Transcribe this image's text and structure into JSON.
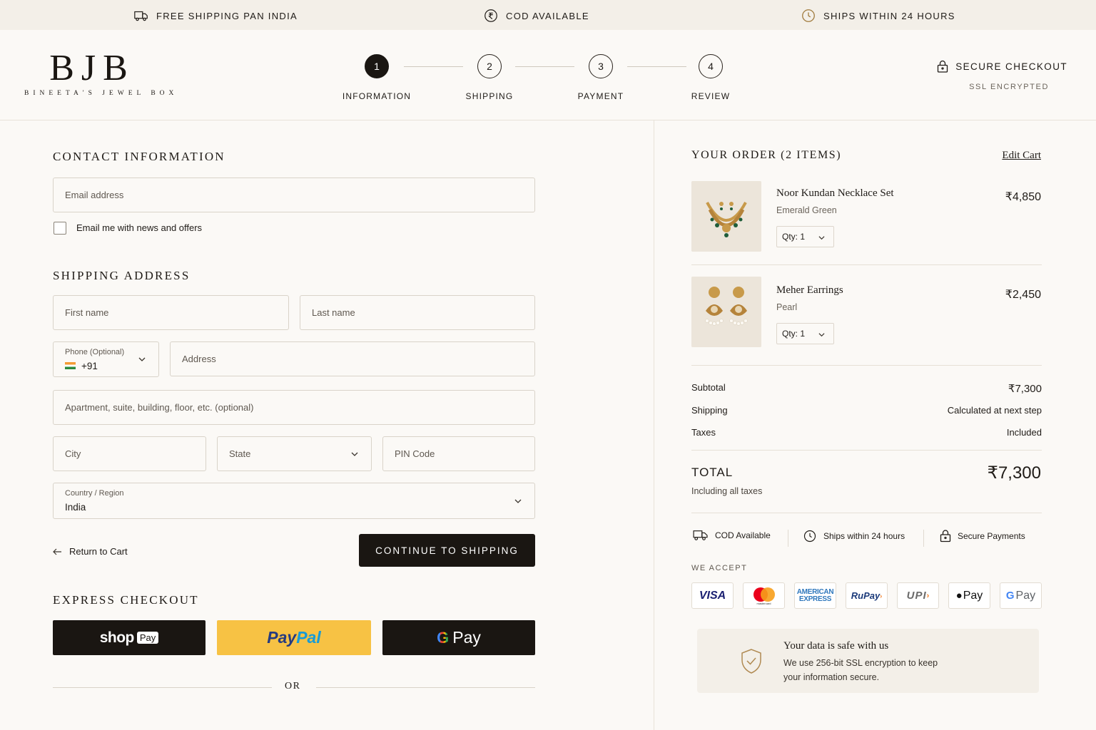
{
  "topbar": {
    "items": [
      {
        "label": "FREE SHIPPING PAN INDIA",
        "icon": "truck-icon"
      },
      {
        "label": "COD AVAILABLE",
        "icon": "rupee-coin-icon"
      },
      {
        "label": "SHIPS WITHIN 24 HOURS",
        "icon": "clock-icon"
      }
    ]
  },
  "brand": {
    "mark": "BJB",
    "name": "BINEETA'S JEWEL BOX"
  },
  "steps": [
    {
      "num": "1",
      "label": "INFORMATION",
      "active": true
    },
    {
      "num": "2",
      "label": "SHIPPING",
      "active": false
    },
    {
      "num": "3",
      "label": "PAYMENT",
      "active": false
    },
    {
      "num": "4",
      "label": "REVIEW",
      "active": false
    }
  ],
  "secure": {
    "title": "SECURE CHECKOUT",
    "sub": "SSL ENCRYPTED"
  },
  "contact": {
    "title": "CONTACT INFORMATION",
    "email_placeholder": "Email address",
    "newsletter_label": "Email me with news and offers"
  },
  "shipping": {
    "title": "SHIPPING ADDRESS",
    "first_name": "First name",
    "last_name": "Last name",
    "phone_label": "Phone (Optional)",
    "phone_code": "+91",
    "address": "Address",
    "apartment": "Apartment, suite, building, floor, etc. (optional)",
    "city": "City",
    "state": "State",
    "pin": "PIN Code",
    "country_label": "Country / Region",
    "country_value": "India"
  },
  "actions": {
    "return": "Return to Cart",
    "continue": "CONTINUE TO SHIPPING"
  },
  "express": {
    "title": "EXPRESS CHECKOUT",
    "shop_pay": "shop",
    "shop_pay_badge": "Pay",
    "paypal_a": "Pay",
    "paypal_b": "Pal",
    "gpay_g": "G",
    "gpay": "Pay",
    "or": "OR"
  },
  "order": {
    "title": "YOUR ORDER (2 ITEMS)",
    "edit": "Edit Cart",
    "items": [
      {
        "name": "Noor Kundan Necklace Set",
        "variant": "Emerald Green",
        "qty": "Qty: 1",
        "price": "₹4,850"
      },
      {
        "name": "Meher Earrings",
        "variant": "Pearl",
        "qty": "Qty: 1",
        "price": "₹2,450"
      }
    ],
    "subtotal_label": "Subtotal",
    "subtotal": "₹7,300",
    "shipping_label": "Shipping",
    "shipping": "Calculated at next step",
    "taxes_label": "Taxes",
    "taxes": "Included",
    "total_label": "TOTAL",
    "total": "₹7,300",
    "total_note": "Including all taxes"
  },
  "trust": [
    {
      "label": "COD Available",
      "icon": "truck-icon"
    },
    {
      "label": "Ships within 24 hours",
      "icon": "clock-icon"
    },
    {
      "label": "Secure Payments",
      "icon": "lock-icon"
    }
  ],
  "accept": {
    "title": "WE ACCEPT",
    "visa": "VISA",
    "mastercard": "mastercard",
    "amex_a": "AMERICAN",
    "amex_b": "EXPRESS",
    "rupay": "RuPay",
    "upi": "UPI",
    "applepay": "Pay",
    "gpay": "Pay"
  },
  "safe": {
    "title": "Your data is safe with us",
    "body_1": "We use 256-bit SSL encryption to keep",
    "body_2": "your information secure."
  },
  "colors": {
    "accent": "#1a1612",
    "paypal_yellow": "#f7c244",
    "gold": "#b08a52"
  }
}
